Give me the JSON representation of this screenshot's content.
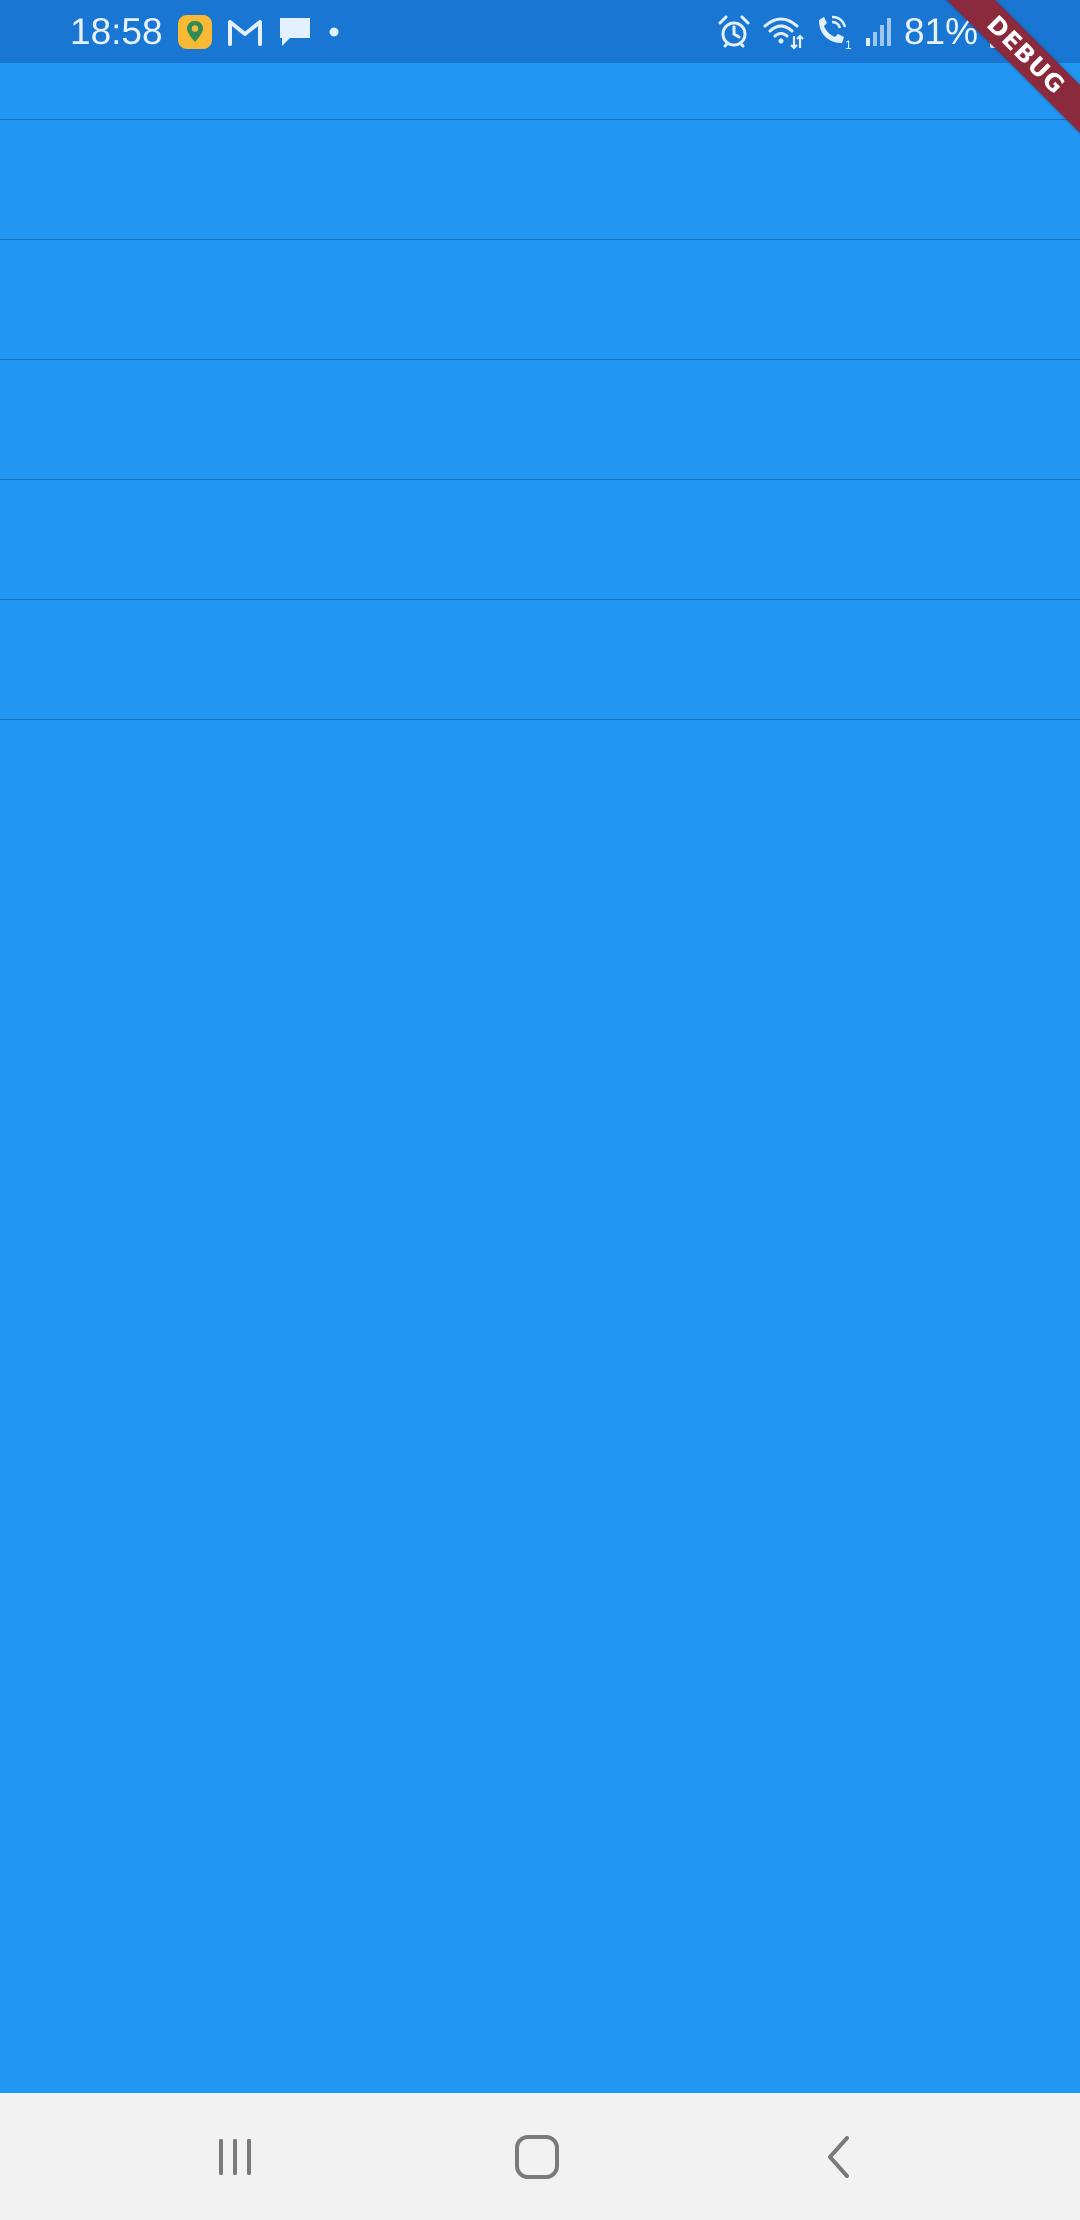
{
  "status_bar": {
    "time": "18:58",
    "battery_percent": "81%",
    "notification_icons": [
      "location-app-icon",
      "gmail-icon",
      "message-icon",
      "more-dot-icon"
    ],
    "system_icons": [
      "alarm-icon",
      "wifi-icon",
      "wifi-calling-icon",
      "signal-icon",
      "battery-charging-icon"
    ]
  },
  "debug_banner": {
    "label": "DEBUG"
  },
  "list": {
    "row_count": 6
  },
  "nav_bar": {
    "buttons": [
      "recents-icon",
      "home-icon",
      "back-icon"
    ]
  },
  "colors": {
    "background": "#2196f3",
    "status_bar": "#1976d2",
    "divider": "#1a6fb5",
    "debug_banner": "#8b2a3c",
    "nav_bar": "#f2f2f2",
    "nav_icon": "#7a7a7a"
  }
}
